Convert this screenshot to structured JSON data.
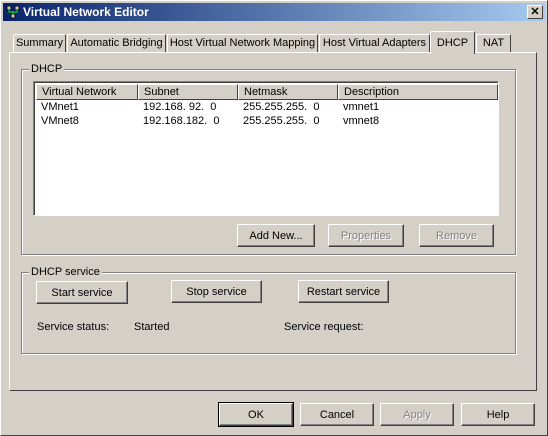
{
  "window": {
    "title": "Virtual Network Editor",
    "close_glyph": "✕"
  },
  "tabs": [
    {
      "label": "Summary"
    },
    {
      "label": "Automatic Bridging"
    },
    {
      "label": "Host Virtual Network Mapping"
    },
    {
      "label": "Host Virtual Adapters"
    },
    {
      "label": "DHCP",
      "active": true
    },
    {
      "label": "NAT"
    }
  ],
  "dhcp_group": {
    "legend": "DHCP",
    "columns": [
      "Virtual Network",
      "Subnet",
      "Netmask",
      "Description"
    ],
    "rows": [
      {
        "network": "VMnet1",
        "subnet": "192.168. 92.  0",
        "netmask": "255.255.255.  0",
        "description": "vmnet1"
      },
      {
        "network": "VMnet8",
        "subnet": "192.168.182.  0",
        "netmask": "255.255.255.  0",
        "description": "vmnet8"
      }
    ],
    "add_new": "Add New...",
    "properties": "Properties",
    "remove": "Remove"
  },
  "service_group": {
    "legend": "DHCP service",
    "start": "Start service",
    "stop": "Stop service",
    "restart": "Restart service",
    "status_label": "Service status:",
    "status_value": "Started",
    "request_label": "Service request:",
    "request_value": ""
  },
  "footer": {
    "ok": "OK",
    "cancel": "Cancel",
    "apply": "Apply",
    "help": "Help"
  }
}
